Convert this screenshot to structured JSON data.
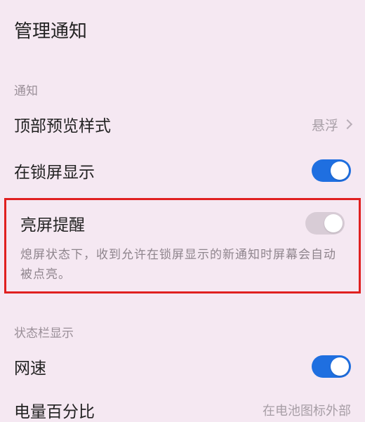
{
  "header": {
    "title": "管理通知"
  },
  "section_notify": {
    "label": "通知"
  },
  "preview_style": {
    "title": "顶部预览样式",
    "value": "悬浮"
  },
  "lock_screen": {
    "title": "在锁屏显示",
    "on": true
  },
  "wake_reminder": {
    "title": "亮屏提醒",
    "on": false,
    "desc": "熄屏状态下，收到允许在锁屏显示的新通知时屏幕会自动被点亮。"
  },
  "section_status": {
    "label": "状态栏显示"
  },
  "net_speed": {
    "title": "网速",
    "on": true
  },
  "battery_pct": {
    "title": "电量百分比",
    "hint": "在电池图标外部"
  }
}
